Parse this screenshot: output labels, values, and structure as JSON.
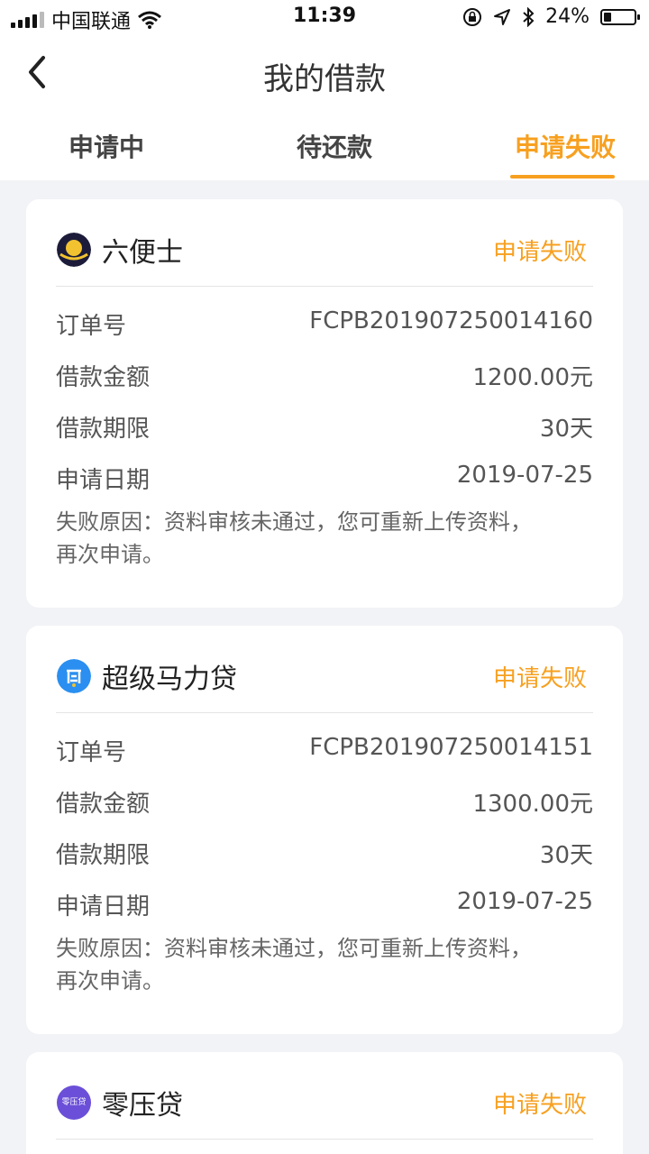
{
  "status_bar": {
    "carrier": "中国联通",
    "time": "11:39",
    "battery": "24%",
    "battery_level": 0.24
  },
  "header": {
    "title": "我的借款"
  },
  "tabs": [
    {
      "label": "申请中",
      "active": false
    },
    {
      "label": "待还款",
      "active": false
    },
    {
      "label": "申请失败",
      "active": true
    }
  ],
  "labels": {
    "order_no": "订单号",
    "amount": "借款金额",
    "term": "借款期限",
    "date": "申请日期"
  },
  "loans": [
    {
      "name": "六便士",
      "status": "申请失败",
      "order_no": "FCPB201907250014160",
      "amount": "1200.00元",
      "term": "30天",
      "date": "2019-07-25",
      "reason": "失败原因：资料审核未通过，您可重新上传资料，再次申请。"
    },
    {
      "name": "超级马力贷",
      "status": "申请失败",
      "order_no": "FCPB201907250014151",
      "amount": "1300.00元",
      "term": "30天",
      "date": "2019-07-25",
      "reason": "失败原因：资料审核未通过，您可重新上传资料，再次申请。"
    },
    {
      "name": "零压贷",
      "status": "申请失败",
      "logo_text": "零压贷"
    }
  ],
  "colors": {
    "accent": "#f7a020",
    "background": "#f2f3f7"
  }
}
